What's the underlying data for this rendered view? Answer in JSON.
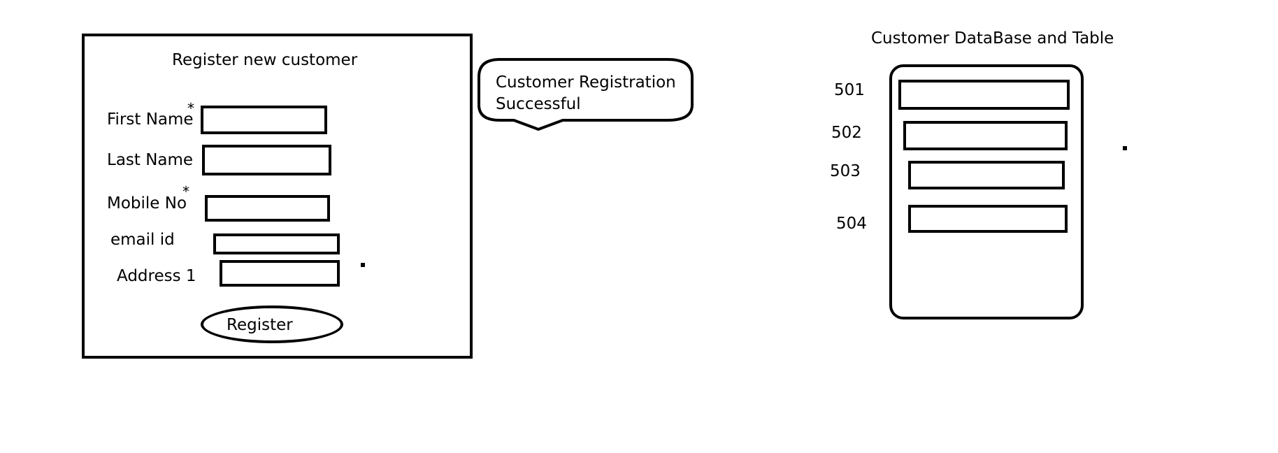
{
  "form": {
    "title": "Register new customer",
    "fields": [
      {
        "label": "First Name",
        "required_mark": "*",
        "value": ""
      },
      {
        "label": "Last Name",
        "required_mark": "",
        "value": ""
      },
      {
        "label": "Mobile No",
        "required_mark": "*",
        "value": ""
      },
      {
        "label": "email id",
        "required_mark": "",
        "value": ""
      },
      {
        "label": "Address 1",
        "required_mark": "",
        "value": ""
      }
    ],
    "register_label": "Register"
  },
  "message": {
    "line1": "Customer Registration",
    "line2": "Successful"
  },
  "database": {
    "title": "Customer DataBase  and Table",
    "records": [
      {
        "id": "501"
      },
      {
        "id": "502"
      },
      {
        "id": "503"
      },
      {
        "id": "504"
      }
    ]
  }
}
